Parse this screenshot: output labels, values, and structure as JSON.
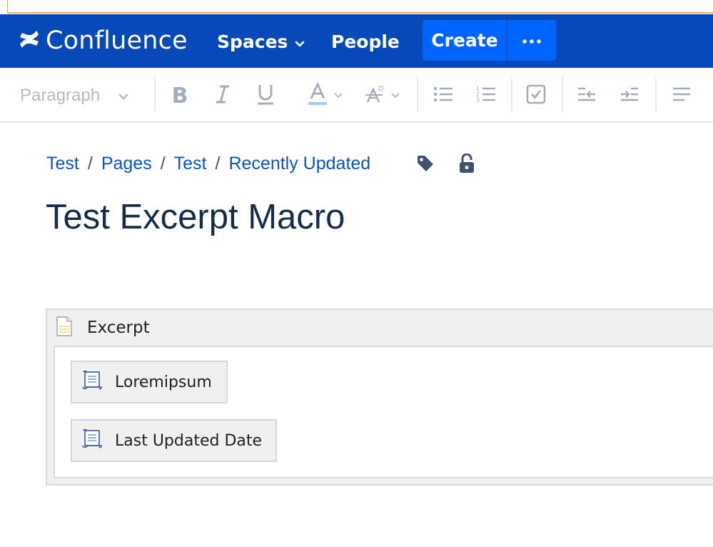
{
  "navbar": {
    "logo_text": "Confluence",
    "spaces_label": "Spaces",
    "people_label": "People",
    "create_label": "Create",
    "more_icon": "ellipsis-icon",
    "background": "#0749b8",
    "accent": "#0065ff"
  },
  "toolbar": {
    "paragraph_label": "Paragraph",
    "buttons": [
      "bold-icon",
      "italic-icon",
      "underline-icon",
      "text-color-icon",
      "text-format-icon",
      "bullet-list-icon",
      "numbered-list-icon",
      "task-list-icon",
      "outdent-icon",
      "indent-icon",
      "align-left-icon"
    ]
  },
  "breadcrumb": {
    "items": [
      "Test",
      "Pages",
      "Test",
      "Recently Updated"
    ],
    "separator": "/",
    "icons": [
      "label-icon",
      "unlock-icon"
    ]
  },
  "page": {
    "title": "Test Excerpt Macro"
  },
  "macro": {
    "name": "Excerpt",
    "children": [
      "Loremipsum",
      "Last Updated Date"
    ]
  }
}
